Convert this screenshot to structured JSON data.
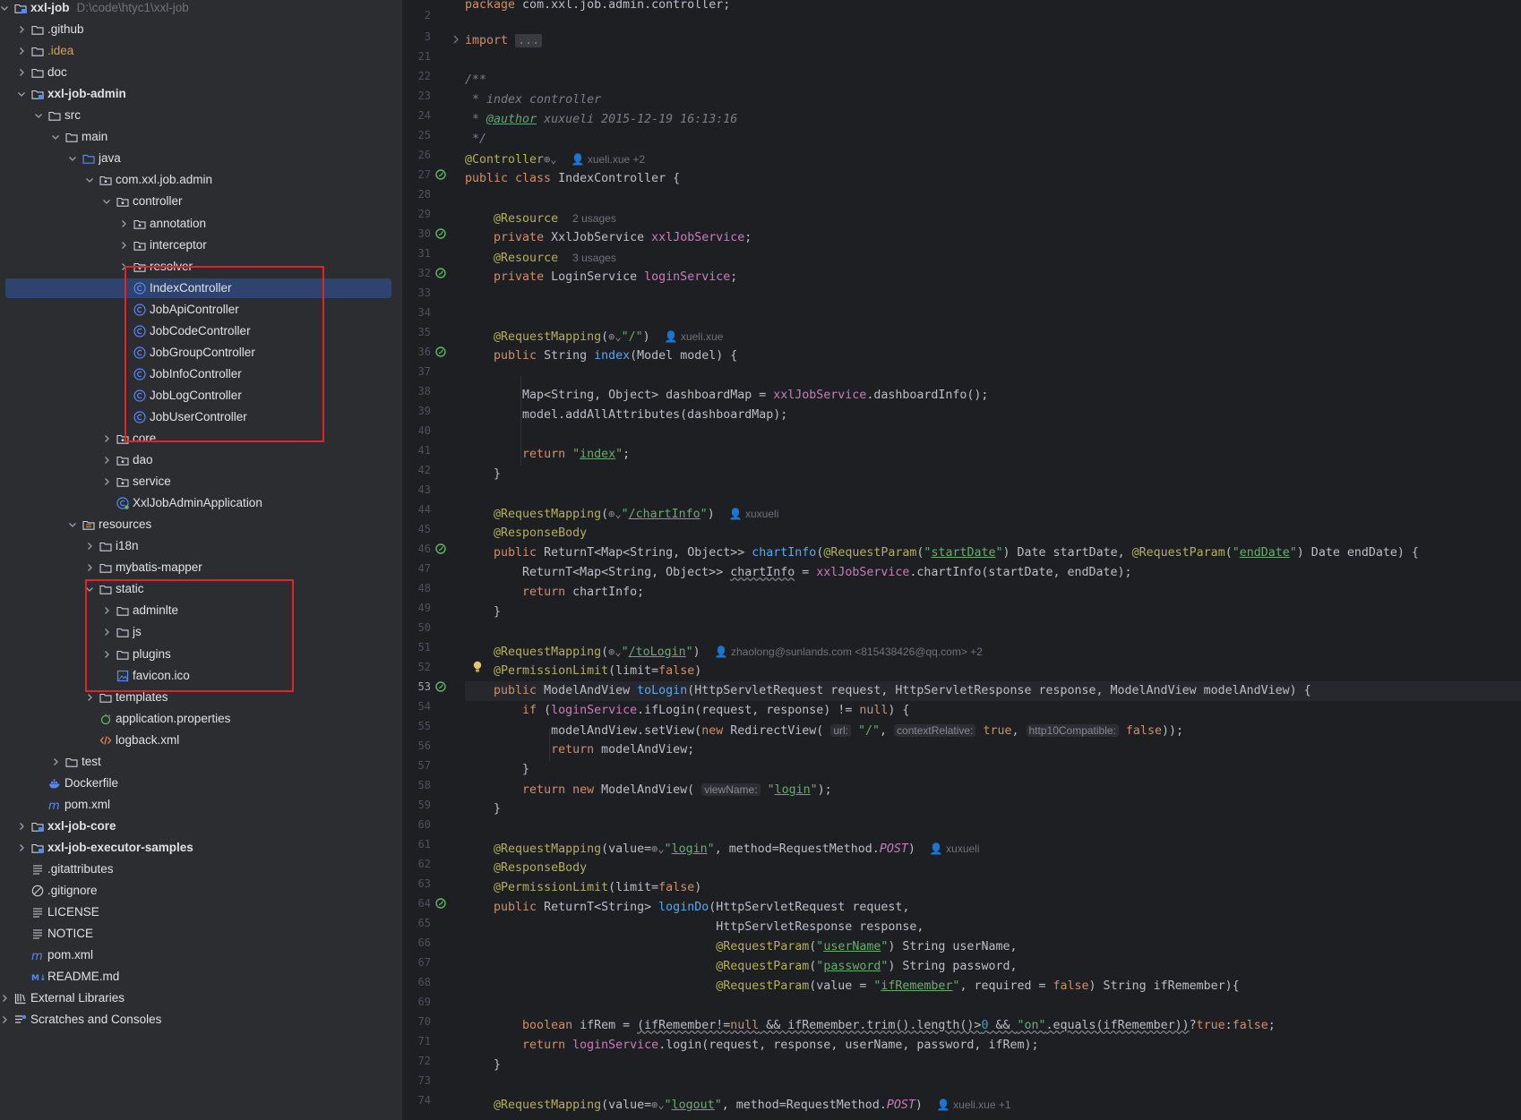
{
  "colors": {
    "selection": "#2e436e",
    "highlight_box": "#e0242a",
    "tree_bg": "#2b2d30",
    "editor_bg": "#1e1f22"
  },
  "tree": {
    "root": {
      "label": "xxl-job",
      "path": "D:\\code\\htyc1\\xxl-job"
    },
    "items": [
      {
        "label": ".github",
        "kind": "folder"
      },
      {
        "label": ".idea",
        "kind": "folder"
      },
      {
        "label": "doc",
        "kind": "folder"
      },
      {
        "label": "xxl-job-admin",
        "kind": "module"
      },
      {
        "label": "src",
        "kind": "folder"
      },
      {
        "label": "main",
        "kind": "folder"
      },
      {
        "label": "java",
        "kind": "source-folder"
      },
      {
        "label": "com.xxl.job.admin",
        "kind": "package"
      },
      {
        "label": "controller",
        "kind": "package"
      },
      {
        "label": "annotation",
        "kind": "package"
      },
      {
        "label": "interceptor",
        "kind": "package"
      },
      {
        "label": "resolver",
        "kind": "package"
      },
      {
        "label": "IndexController",
        "kind": "class"
      },
      {
        "label": "JobApiController",
        "kind": "class"
      },
      {
        "label": "JobCodeController",
        "kind": "class"
      },
      {
        "label": "JobGroupController",
        "kind": "class"
      },
      {
        "label": "JobInfoController",
        "kind": "class"
      },
      {
        "label": "JobLogController",
        "kind": "class"
      },
      {
        "label": "JobUserController",
        "kind": "class"
      },
      {
        "label": "core",
        "kind": "package"
      },
      {
        "label": "dao",
        "kind": "package"
      },
      {
        "label": "service",
        "kind": "package"
      },
      {
        "label": "XxlJobAdminApplication",
        "kind": "spring-class"
      },
      {
        "label": "resources",
        "kind": "resource-folder"
      },
      {
        "label": "i18n",
        "kind": "folder"
      },
      {
        "label": "mybatis-mapper",
        "kind": "folder"
      },
      {
        "label": "static",
        "kind": "folder"
      },
      {
        "label": "adminlte",
        "kind": "folder"
      },
      {
        "label": "js",
        "kind": "folder"
      },
      {
        "label": "plugins",
        "kind": "folder"
      },
      {
        "label": "favicon.ico",
        "kind": "image-file"
      },
      {
        "label": "templates",
        "kind": "folder"
      },
      {
        "label": "application.properties",
        "kind": "properties-file"
      },
      {
        "label": "logback.xml",
        "kind": "xml-file"
      },
      {
        "label": "test",
        "kind": "folder"
      },
      {
        "label": "Dockerfile",
        "kind": "docker-file"
      },
      {
        "label": "pom.xml",
        "kind": "maven-file"
      },
      {
        "label": "xxl-job-core",
        "kind": "module"
      },
      {
        "label": "xxl-job-executor-samples",
        "kind": "module"
      },
      {
        "label": ".gitattributes",
        "kind": "text-file"
      },
      {
        "label": ".gitignore",
        "kind": "ignore-file"
      },
      {
        "label": "LICENSE",
        "kind": "text-file"
      },
      {
        "label": "NOTICE",
        "kind": "text-file"
      },
      {
        "label": "pom.xml",
        "kind": "maven-file"
      },
      {
        "label": "README.md",
        "kind": "markdown-file"
      },
      {
        "label": "External Libraries",
        "kind": "libraries"
      },
      {
        "label": "Scratches and Consoles",
        "kind": "scratches"
      }
    ]
  },
  "editor": {
    "line_numbers": [
      "2",
      "3",
      "21",
      "22",
      "23",
      "24",
      "25",
      "26",
      "27",
      "28",
      "29",
      "30",
      "31",
      "32",
      "33",
      "34",
      "35",
      "36",
      "37",
      "38",
      "39",
      "40",
      "41",
      "42",
      "43",
      "44",
      "45",
      "46",
      "47",
      "48",
      "49",
      "50",
      "51",
      "52",
      "53",
      "54",
      "55",
      "56",
      "57",
      "58",
      "59",
      "60",
      "61",
      "62",
      "63",
      "64",
      "65",
      "66",
      "67",
      "68",
      "69",
      "70",
      "71",
      "72",
      "73",
      "74"
    ],
    "current_line": "53",
    "fold_placeholder": "...",
    "authors": {
      "class": "xueli.xue +2",
      "index": "xueli.xue",
      "chart": "xuxueli",
      "tologin": "zhaolong@sunlands.com <815438426@qq.com> +2",
      "login": "xuxueli",
      "logout": "xueli.xue +1"
    },
    "usages": {
      "xxlJobService": "2 usages",
      "loginService": "3 usages"
    },
    "param_hints": {
      "url": "url:",
      "contextRelative": "contextRelative:",
      "http10": "http10Compatible:",
      "viewName": "viewName:"
    }
  }
}
